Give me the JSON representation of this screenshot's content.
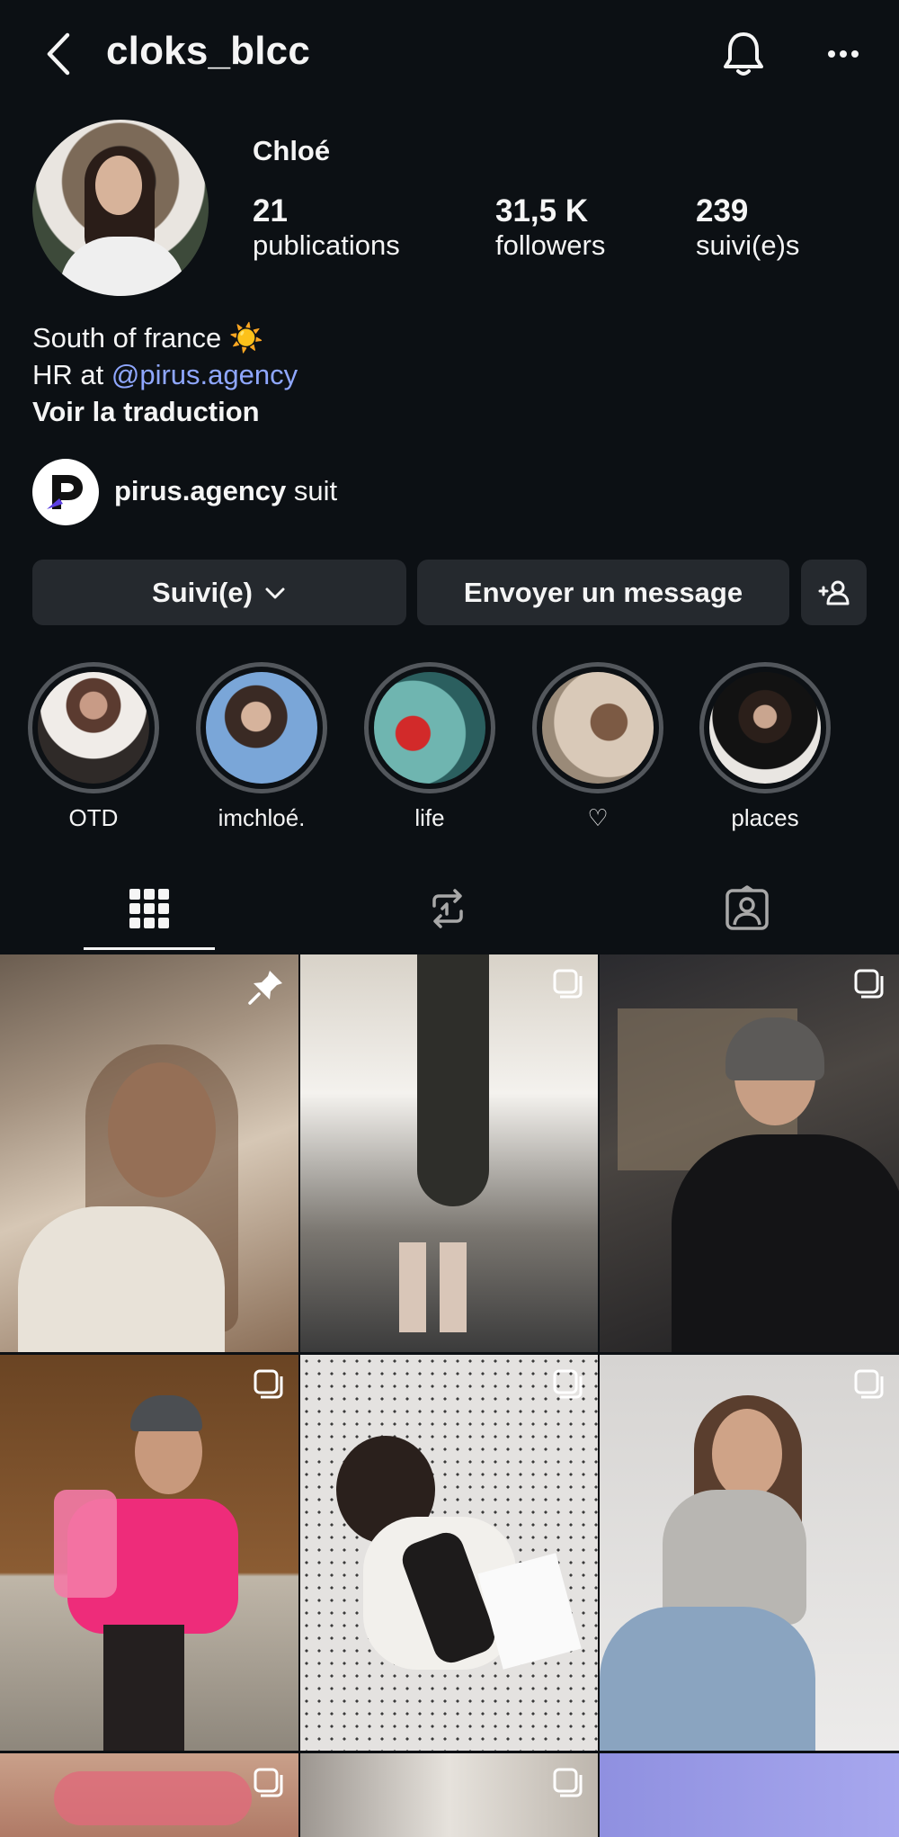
{
  "header": {
    "username": "cloks_blcc",
    "back_icon": "chevron-left-icon",
    "bell_icon": "bell-icon",
    "more_icon": "more-horizontal-icon"
  },
  "profile": {
    "display_name": "Chloé",
    "stats": [
      {
        "value": "21",
        "label": "publications"
      },
      {
        "value": "31,5 K",
        "label": "followers"
      },
      {
        "value": "239",
        "label": "suivi(e)s"
      }
    ],
    "bio": {
      "line1": "South of france ☀️",
      "line2_prefix": "HR at ",
      "line2_mention": "@pirus.agency",
      "translate": "Voir la traduction"
    },
    "followed_by": {
      "account": "pirus.agency",
      "suffix": " suit"
    }
  },
  "actions": {
    "follow_label": "Suivi(e)",
    "message_label": "Envoyer un message"
  },
  "highlights": [
    {
      "label": "OTD"
    },
    {
      "label": "imchloé."
    },
    {
      "label": "life"
    },
    {
      "label": "♡"
    },
    {
      "label": "places"
    }
  ],
  "tabs": [
    "grid-icon",
    "reposts-icon",
    "tagged-icon"
  ],
  "colors": {
    "background": "#0c1014",
    "button": "#25292e",
    "mention": "#8fa7ff"
  }
}
